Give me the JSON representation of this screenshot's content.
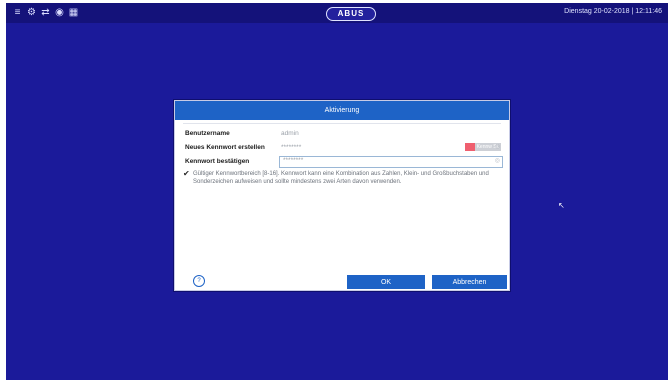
{
  "topbar": {
    "brand": "ABUS",
    "clock": "Dienstag 20-02-2018 | 12:11:46",
    "icons": [
      "menu-icon",
      "settings-icon",
      "network-icon",
      "record-icon",
      "layout-grid-icon"
    ]
  },
  "dialog": {
    "title": "Aktivierung",
    "fields": {
      "username_label": "Benutzername",
      "username_value": "admin",
      "new_password_label": "Neues Kennwort erstellen",
      "new_password_value": "********",
      "strength_label": "Kennw St.",
      "confirm_password_label": "Kennwort bestätigen",
      "confirm_password_value": "********"
    },
    "hint": "Gültiger Kennwortbereich [8-16]. Kennwort kann eine Kombination aus Zahlen, Klein- und Großbuchstaben und Sonderzeichen aufweisen und sollte mindestens zwei Arten davon verwenden.",
    "buttons": {
      "ok": "OK",
      "cancel": "Abbrechen"
    }
  },
  "colors": {
    "desktop": "#1b1a9a",
    "title_bar": "#1e63c6",
    "button": "#1e63c6",
    "strength_weak": "#ef5f6f"
  }
}
